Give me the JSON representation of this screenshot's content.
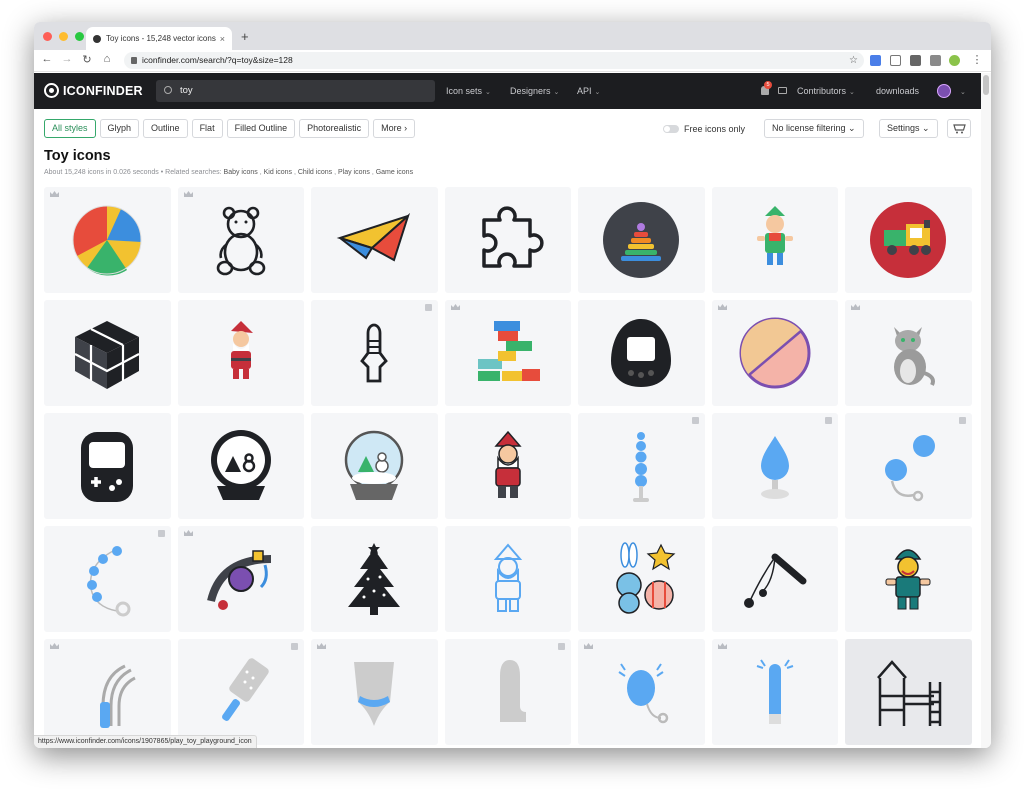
{
  "browser": {
    "tab_title": "Toy icons - 15,248 vector icons",
    "tab_close": "×",
    "new_tab": "+",
    "url": "iconfinder.com/search/?q=toy&size=128",
    "status_url": "https://www.iconfinder.com/icons/1907865/play_toy_playground_icon",
    "nav": {
      "back": "←",
      "forward": "→",
      "reload": "↻",
      "home": "⌂",
      "bookmark": "☆",
      "menu": "⋮"
    }
  },
  "header": {
    "logo": "ICONFINDER",
    "search_value": "toy",
    "nav_items": [
      "Icon sets",
      "Designers",
      "API"
    ],
    "notifications_count": "5",
    "contributors": "Contributors",
    "user": "downloads",
    "caret": "⌄"
  },
  "filters": {
    "styles": [
      "All styles",
      "Glyph",
      "Outline",
      "Flat",
      "Filled Outline",
      "Photorealistic",
      "More ›"
    ],
    "active": "All styles",
    "free_label": "Free icons only",
    "license": "No license filtering ⌄",
    "settings": "Settings ⌄",
    "cart_icon": "cart-icon"
  },
  "page": {
    "title": "Toy icons",
    "summary": "About 15,248 icons in 0.026 seconds • Related searches:",
    "related": [
      "Baby icons",
      "Kid icons",
      "Child icons",
      "Play icons",
      "Game icons"
    ],
    "separator": " , "
  },
  "icons": [
    {
      "name": "beach-ball-icon",
      "badge": "crown"
    },
    {
      "name": "teddy-bear-icon",
      "badge": "crown"
    },
    {
      "name": "paper-plane-icon",
      "badge": "none"
    },
    {
      "name": "puzzle-piece-icon",
      "badge": "none"
    },
    {
      "name": "ring-stacker-icon",
      "badge": "none"
    },
    {
      "name": "elf-doll-icon",
      "badge": "none"
    },
    {
      "name": "toy-train-icon",
      "badge": "none"
    },
    {
      "name": "cube-icon",
      "badge": "none"
    },
    {
      "name": "santa-doll-icon",
      "badge": "none"
    },
    {
      "name": "dildo-outline-icon",
      "badge": "download"
    },
    {
      "name": "building-blocks-icon",
      "badge": "crown"
    },
    {
      "name": "tamagotchi-icon",
      "badge": "none"
    },
    {
      "name": "ball-icon",
      "badge": "crown"
    },
    {
      "name": "cat-icon",
      "badge": "crown"
    },
    {
      "name": "handheld-game-icon",
      "badge": "none"
    },
    {
      "name": "snow-globe-icon",
      "badge": "none"
    },
    {
      "name": "snow-globe-color-icon",
      "badge": "none"
    },
    {
      "name": "santa-icon",
      "badge": "none"
    },
    {
      "name": "anal-beads-icon",
      "badge": "download"
    },
    {
      "name": "butt-plug-icon",
      "badge": "download"
    },
    {
      "name": "ben-wa-balls-icon",
      "badge": "download"
    },
    {
      "name": "beads-icon",
      "badge": "download"
    },
    {
      "name": "gag-ball-icon",
      "badge": "crown"
    },
    {
      "name": "christmas-tree-icon",
      "badge": "none"
    },
    {
      "name": "santa-outline-icon",
      "badge": "none"
    },
    {
      "name": "bunny-bear-toys-icon",
      "badge": "none"
    },
    {
      "name": "flail-icon",
      "badge": "none"
    },
    {
      "name": "elf-toy-icon",
      "badge": "none"
    },
    {
      "name": "whip-icon",
      "badge": "crown"
    },
    {
      "name": "paddle-icon",
      "badge": "download"
    },
    {
      "name": "panties-icon",
      "badge": "crown"
    },
    {
      "name": "dildo-icon",
      "badge": "download"
    },
    {
      "name": "vibrating-egg-icon",
      "badge": "crown"
    },
    {
      "name": "vibrator-icon",
      "badge": "crown"
    },
    {
      "name": "playground-icon",
      "badge": "none"
    }
  ],
  "colors": {
    "accent": "#35a86b",
    "header_bg": "#1c1d20",
    "cell_bg": "#f5f6f8"
  }
}
